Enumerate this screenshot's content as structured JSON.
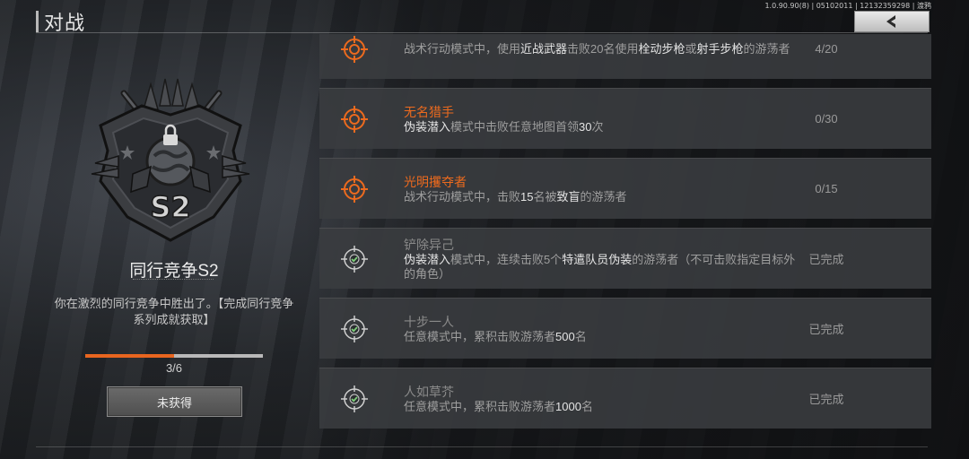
{
  "header": {
    "title": "对战",
    "version_text": "1.0.90.90(8) | 05102011 | 12132359298 | 渡鸦",
    "back_icon": "chevron-left-icon"
  },
  "achievement": {
    "emblem_icon": "locked-badge-emblem",
    "emblem_letter": "S2",
    "name": "同行竞争S2",
    "description": "你在激烈的同行竞争中胜出了。【完成同行竞争系列成就获取】",
    "progress": {
      "current": 3,
      "total": 6,
      "text": "3/6"
    },
    "status_button": "未获得"
  },
  "tasks": [
    {
      "icon": "crosshair-target-icon",
      "name": "",
      "desc_parts": [
        "战术行动模式中，使用",
        "近战武器",
        "击败20名使用",
        "栓动步枪",
        "或",
        "射手步枪",
        "的游荡者"
      ],
      "count": "4/20",
      "state": "active"
    },
    {
      "icon": "crosshair-target-icon",
      "name": "无名猎手",
      "desc_parts": [
        "伪装潜入",
        "模式中击败任意地图首领",
        "30",
        "次"
      ],
      "count": "0/30",
      "state": "active"
    },
    {
      "icon": "crosshair-target-icon",
      "name": "光明攫夺者",
      "desc_parts": [
        "战术行动模式中，击败",
        "15",
        "名被",
        "致盲",
        "的游荡者"
      ],
      "count": "0/15",
      "state": "active"
    },
    {
      "icon": "completed-check-icon",
      "name": "铲除异己",
      "desc_parts": [
        "伪装潜入",
        "模式中，连续击败5个",
        "特遣队员",
        "伪装",
        "的游荡者（不可击败指定目标外的角色）"
      ],
      "count": "已完成",
      "state": "done"
    },
    {
      "icon": "completed-check-icon",
      "name": "十步一人",
      "desc_parts": [
        "任意模式中，累积击败游荡者",
        "500",
        "名"
      ],
      "count": "已完成",
      "state": "done"
    },
    {
      "icon": "completed-check-icon",
      "name": "人如草芥",
      "desc_parts": [
        "任意模式中，累积击败游荡者",
        "1000",
        "名"
      ],
      "count": "已完成",
      "state": "done"
    }
  ],
  "colors": {
    "accent": "#ec6a1e",
    "done_check": "#7ed07a"
  }
}
